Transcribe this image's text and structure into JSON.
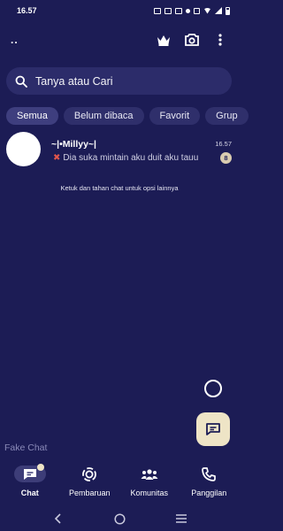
{
  "status_bar": {
    "time": "16.57"
  },
  "header": {
    "title": "..",
    "icons": [
      "crown-icon",
      "camera-icon",
      "more-vert-icon"
    ]
  },
  "search": {
    "placeholder": "Tanya atau Cari"
  },
  "filters": [
    {
      "label": "Semua",
      "active": true
    },
    {
      "label": "Belum dibaca",
      "active": false
    },
    {
      "label": "Favorit",
      "active": false
    },
    {
      "label": "Grup",
      "active": false
    }
  ],
  "chats": [
    {
      "name": "~|•Millyy~|",
      "time": "16.57",
      "preview": "Dia suka mintain aku duit aku tauu",
      "status_icon": "x-icon",
      "unread": "8"
    }
  ],
  "hint": "Ketuk dan tahan chat untuk opsi lainnya",
  "fake_chat_label": "Fake Chat",
  "bottom_nav": [
    {
      "label": "Chat",
      "icon": "chat-icon",
      "active": true
    },
    {
      "label": "Pembaruan",
      "icon": "updates-icon",
      "active": false
    },
    {
      "label": "Komunitas",
      "icon": "communities-icon",
      "active": false
    },
    {
      "label": "Panggilan",
      "icon": "phone-icon",
      "active": false
    }
  ],
  "colors": {
    "background": "#1c1c55",
    "accent": "#eee4c6",
    "chip_bg": "#2f2f6b",
    "x_mark": "#e2564b"
  }
}
